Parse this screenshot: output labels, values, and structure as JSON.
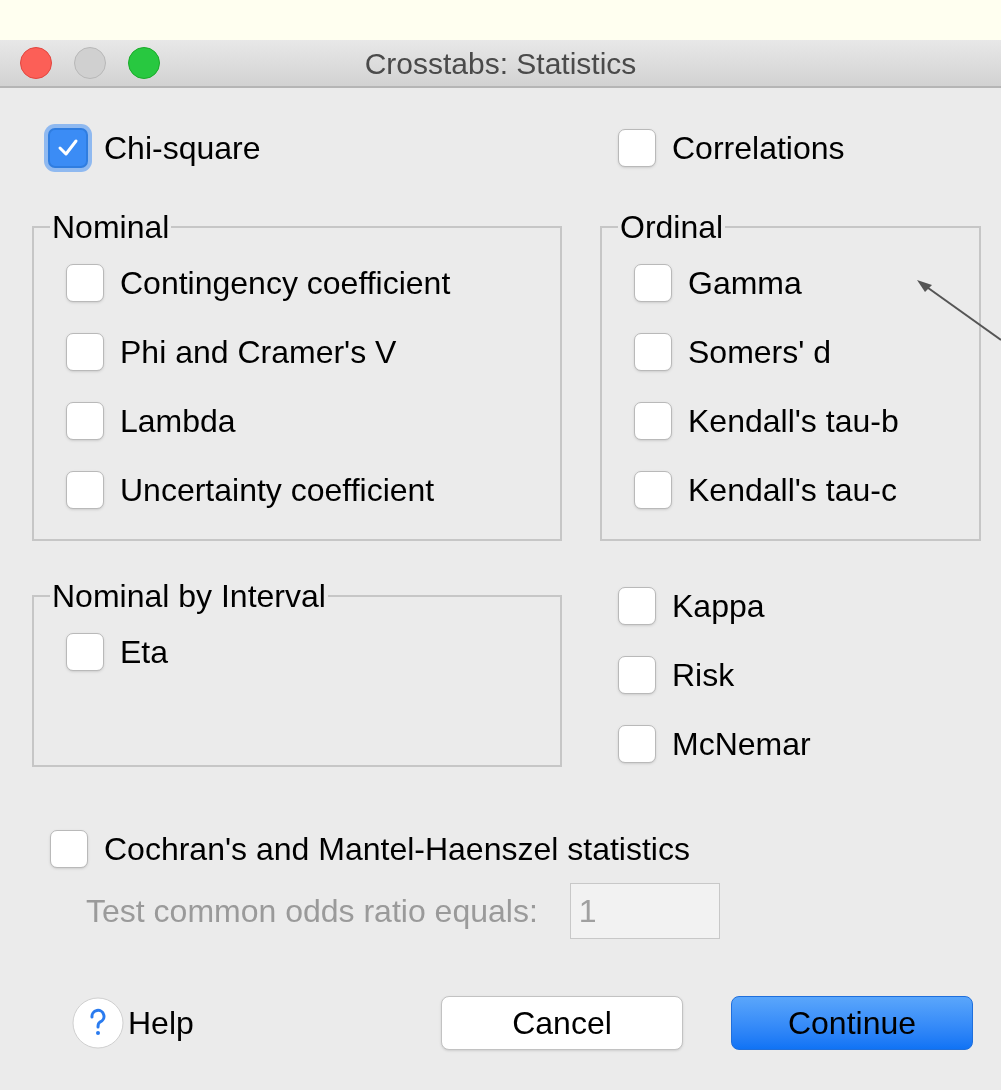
{
  "window": {
    "title": "Crosstabs: Statistics"
  },
  "top_options": [
    {
      "label": "Chi-square",
      "checked": true
    },
    {
      "label": "Correlations",
      "checked": false
    }
  ],
  "nominal": {
    "title": "Nominal",
    "options": [
      {
        "label": "Contingency coefficient",
        "checked": false
      },
      {
        "label": "Phi and Cramer's V",
        "checked": false
      },
      {
        "label": "Lambda",
        "checked": false
      },
      {
        "label": "Uncertainty coefficient",
        "checked": false
      }
    ]
  },
  "ordinal": {
    "title": "Ordinal",
    "options": [
      {
        "label": "Gamma",
        "checked": false
      },
      {
        "label": "Somers' d",
        "checked": false
      },
      {
        "label": "Kendall's tau-b",
        "checked": false
      },
      {
        "label": "Kendall's tau-c",
        "checked": false
      }
    ]
  },
  "nominal_by_interval": {
    "title": "Nominal by Interval",
    "options": [
      {
        "label": "Eta",
        "checked": false
      }
    ]
  },
  "other_options": [
    {
      "label": "Kappa",
      "checked": false
    },
    {
      "label": "Risk",
      "checked": false
    },
    {
      "label": "McNemar",
      "checked": false
    }
  ],
  "cochran": {
    "label": "Cochran's and Mantel-Haenszel statistics",
    "checked": false
  },
  "odds_ratio": {
    "label": "Test common odds ratio equals:",
    "value": "1",
    "disabled": true
  },
  "buttons": [
    {
      "label": "Help",
      "kind": "help"
    },
    {
      "label": "Cancel",
      "kind": "normal"
    },
    {
      "label": "Continue",
      "kind": "default"
    }
  ]
}
